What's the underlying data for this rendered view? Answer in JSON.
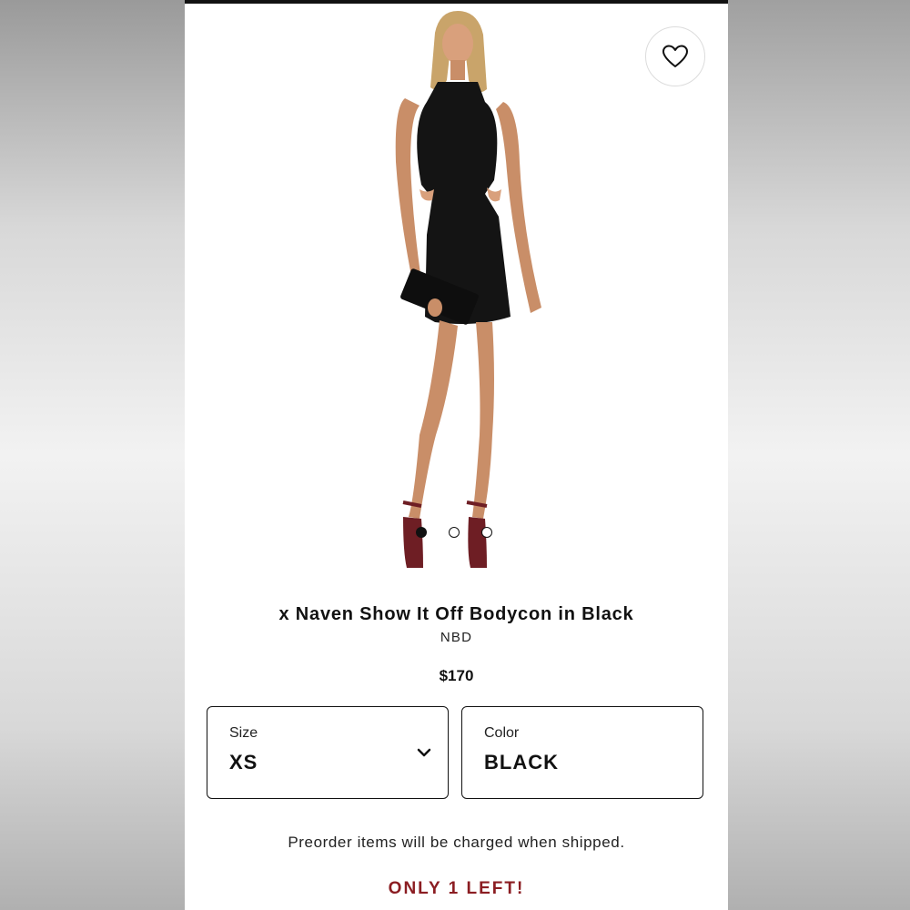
{
  "product": {
    "title": "x Naven Show It Off Bodycon in Black",
    "brand": "NBD",
    "price": "$170",
    "image_dots": {
      "count": 3,
      "active_index": 0
    }
  },
  "size_selector": {
    "label": "Size",
    "value": "XS"
  },
  "color_selector": {
    "label": "Color",
    "value": "BLACK"
  },
  "notice_text": "Preorder items will be charged when shipped.",
  "stock_text": "ONLY 1 LEFT!",
  "icons": {
    "favorite": "heart-icon",
    "dropdown": "chevron-down-icon"
  },
  "colors": {
    "stock_alert": "#8b1d22",
    "text": "#111111",
    "background": "#ffffff"
  }
}
